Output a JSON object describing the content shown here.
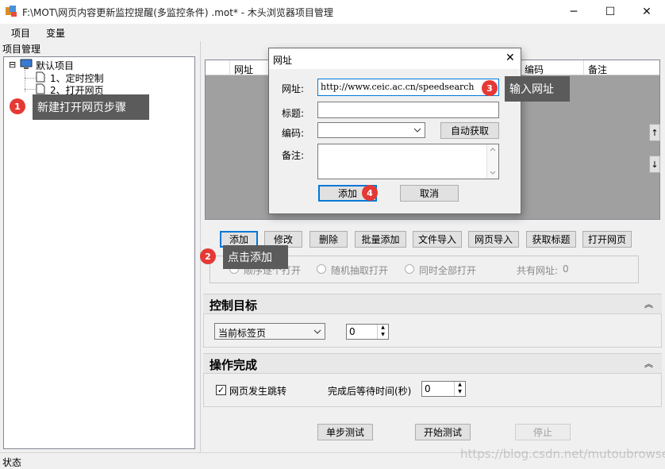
{
  "window": {
    "title": "F:\\MOT\\网页内容更新监控提醒(多监控条件) .mot* - 木头浏览器项目管理",
    "minimize": "─",
    "maximize": "☐",
    "close": "✕"
  },
  "menu": {
    "project": "项目",
    "variables": "变量"
  },
  "left_panel": {
    "title": "项目管理",
    "tree_root": "默认项目",
    "tree_items": [
      "1、定时控制",
      "2、打开网页"
    ],
    "expander": "⊟"
  },
  "url_table": {
    "headers": [
      "网址",
      "编码",
      "备注"
    ]
  },
  "scroll": {
    "up": "↑",
    "down": "↓"
  },
  "action_buttons": [
    "添加",
    "修改",
    "删除",
    "批量添加",
    "文件导入",
    "网页导入",
    "获取标题",
    "打开网页"
  ],
  "open_mode": {
    "options": [
      "顺序逐个打开",
      "随机抽取打开",
      "同时全部打开"
    ],
    "count_label": "共有网址:",
    "count_value": "0"
  },
  "control_target": {
    "title": "控制目标",
    "select_value": "当前标签页",
    "spin_value": "0",
    "collapse": "︽"
  },
  "operation_complete": {
    "title": "操作完成",
    "checkbox_label": "网页发生跳转",
    "checkbox_checked": true,
    "wait_label": "完成后等待时间(秒)",
    "wait_value": "0",
    "collapse": "︽"
  },
  "bottom_buttons": {
    "step_test": "单步测试",
    "start_test": "开始测试",
    "stop": "停止"
  },
  "status": {
    "label": "状态"
  },
  "watermark": "https://blog.csdn.net/mutoubrowser",
  "dialog": {
    "title": "网址",
    "close": "✕",
    "url_label": "网址:",
    "url_value": "http://www.ceic.ac.cn/speedsearch",
    "title_label": "标题:",
    "title_value": "",
    "encoding_label": "编码:",
    "encoding_value": "",
    "auto_detect": "自动获取",
    "note_label": "备注:",
    "add": "添加",
    "cancel": "取消"
  },
  "annotations": [
    {
      "number": "1",
      "text": "新建打开网页步骤"
    },
    {
      "number": "2",
      "text": "点击添加"
    },
    {
      "number": "3",
      "text": "输入网址"
    },
    {
      "number": "4",
      "text": ""
    }
  ],
  "colors": {
    "accent": "#0078d7",
    "badge": "#e53935",
    "callout": "#5b5b5b",
    "table_bg": "#a0a0a0"
  }
}
